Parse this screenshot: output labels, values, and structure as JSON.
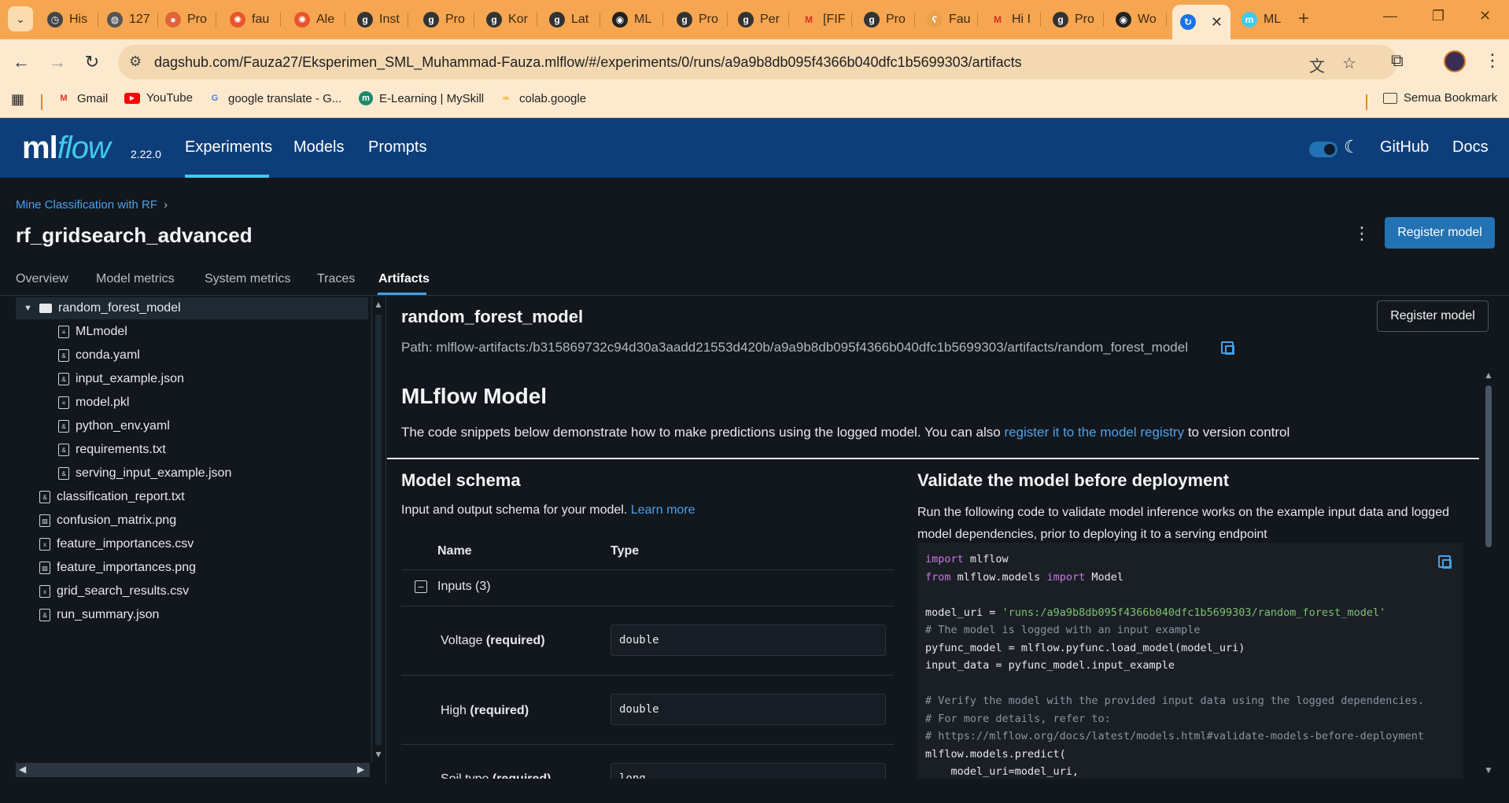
{
  "browser": {
    "tabs": [
      {
        "label": "His",
        "icon": "history-icon",
        "color": "#444444"
      },
      {
        "label": "127",
        "icon": "globe-icon",
        "color": "#555555"
      },
      {
        "label": "Pro",
        "icon": "avatar-icon",
        "color": "#e0643a"
      },
      {
        "label": "fau",
        "icon": "grafana-icon",
        "color": "#e8552b"
      },
      {
        "label": "Ale",
        "icon": "grafana-icon",
        "color": "#e8552b"
      },
      {
        "label": "Inst",
        "icon": "dagshub-icon",
        "color": "#333333"
      },
      {
        "label": "Pro",
        "icon": "dagshub-icon",
        "color": "#333333"
      },
      {
        "label": "Kor",
        "icon": "dagshub-icon",
        "color": "#333333"
      },
      {
        "label": "Lat",
        "icon": "dagshub-icon",
        "color": "#333333"
      },
      {
        "label": "ML",
        "icon": "github-icon",
        "color": "#222222"
      },
      {
        "label": "Pro",
        "icon": "dagshub-icon",
        "color": "#333333"
      },
      {
        "label": "Per",
        "icon": "dagshub-icon",
        "color": "#333333"
      },
      {
        "label": "[FIF",
        "icon": "gmail-icon",
        "color": "#d93025"
      },
      {
        "label": "Pro",
        "icon": "dagshub-icon",
        "color": "#333333"
      },
      {
        "label": "Fau",
        "icon": "bear-icon",
        "color": "#e8a14a"
      },
      {
        "label": "Hi I",
        "icon": "gmail-icon",
        "color": "#d93025"
      },
      {
        "label": "Pro",
        "icon": "dagshub-icon",
        "color": "#333333"
      },
      {
        "label": "Wo",
        "icon": "github-icon",
        "color": "#222222"
      }
    ],
    "active_tab": {
      "label": "",
      "icon": "loading-icon"
    },
    "last_tab": {
      "label": "ML",
      "icon": "mlflow-icon"
    },
    "url": "dagshub.com/Fauza27/Eksperimen_SML_Muhammad-Fauza.mlflow/#/experiments/0/runs/a9a9b8db095f4366b040dfc1b5699303/artifacts",
    "bookmarks": [
      {
        "label": "Gmail",
        "icon": "gmail-icon"
      },
      {
        "label": "YouTube",
        "icon": "youtube-icon"
      },
      {
        "label": "google translate - G...",
        "icon": "google-icon"
      },
      {
        "label": "E-Learning | MySkill",
        "icon": "myskill-icon"
      },
      {
        "label": "colab.google",
        "icon": "colab-icon"
      }
    ],
    "all_bookmarks": "Semua Bookmark"
  },
  "mlflow": {
    "logo_ml": "ml",
    "logo_flow": "flow",
    "version": "2.22.0",
    "nav": [
      "Experiments",
      "Models",
      "Prompts"
    ],
    "github": "GitHub",
    "docs": "Docs"
  },
  "page": {
    "breadcrumb": "Mine Classification with RF",
    "title": "rf_gridsearch_advanced",
    "register_button": "Register model",
    "tabs": [
      "Overview",
      "Model metrics",
      "System metrics",
      "Traces",
      "Artifacts"
    ],
    "active_tab": "Artifacts"
  },
  "tree": {
    "folder": "random_forest_model",
    "children": [
      "MLmodel",
      "conda.yaml",
      "input_example.json",
      "model.pkl",
      "python_env.yaml",
      "requirements.txt",
      "serving_input_example.json"
    ],
    "files": [
      "classification_report.txt",
      "confusion_matrix.png",
      "feature_importances.csv",
      "feature_importances.png",
      "grid_search_results.csv",
      "run_summary.json"
    ]
  },
  "artifact": {
    "name": "random_forest_model",
    "register_button": "Register model",
    "path": "Path: mlflow-artifacts:/b315869732c94d30a3aadd21553d420b/a9a9b8db095f4366b040dfc1b5699303/artifacts/random_forest_model",
    "mlmodel_title": "MLflow Model",
    "desc_before": "The code snippets below demonstrate how to make predictions using the logged model. You can also ",
    "desc_link": "register it to the model registry",
    "desc_after": " to version control",
    "schema_title": "Model schema",
    "schema_desc": "Input and output schema for your model. ",
    "schema_link": "Learn more",
    "col_name": "Name",
    "col_type": "Type",
    "inputs_label": "Inputs (3)",
    "fields": [
      {
        "name": "Voltage",
        "req": "(required)",
        "type": "double"
      },
      {
        "name": "High",
        "req": "(required)",
        "type": "double"
      },
      {
        "name": "Soil type",
        "req": "(required)",
        "type": "long"
      }
    ],
    "validate_title": "Validate the model before deployment",
    "validate_desc": "Run the following code to validate model inference works on the example input data and logged model dependencies, prior to deploying it to a serving endpoint"
  }
}
